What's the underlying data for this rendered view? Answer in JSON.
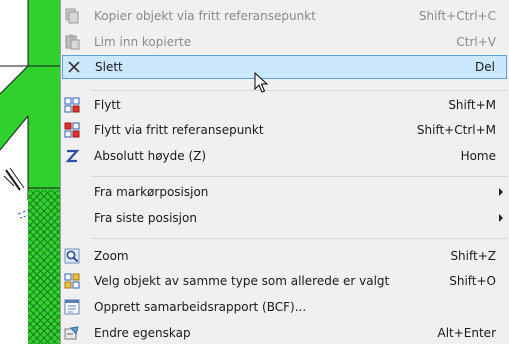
{
  "colors": {
    "menu_background": "#f0f0f0",
    "selected_highlight": "#cce8ff",
    "selected_border": "#5aa1e0",
    "canvas_green": "#2fd12f",
    "disabled_text": "#8a8a8a"
  },
  "menu": {
    "items": [
      {
        "label": "Kopier objekt via fritt referansepunkt",
        "shortcut": "Shift+Ctrl+C",
        "icon": "copy-icon",
        "state": "disabled"
      },
      {
        "label": "Lim inn kopierte",
        "shortcut": "Ctrl+V",
        "icon": "paste-icon",
        "state": "disabled"
      },
      {
        "label": "Slett",
        "shortcut": "Del",
        "icon": "delete-x-icon",
        "state": "selected"
      },
      {
        "label": "Flytt",
        "shortcut": "Shift+M",
        "icon": "move-icon",
        "state": "enabled"
      },
      {
        "label": "Flytt via fritt referansepunkt",
        "shortcut": "Shift+Ctrl+M",
        "icon": "move-reference-icon",
        "state": "enabled"
      },
      {
        "label": "Absolutt høyde (Z)",
        "shortcut": "Home",
        "icon": "z-height-icon",
        "state": "enabled"
      },
      {
        "label": "Fra markørposisjon",
        "shortcut": "",
        "icon": "",
        "state": "submenu"
      },
      {
        "label": "Fra siste posisjon",
        "shortcut": "",
        "icon": "",
        "state": "submenu"
      },
      {
        "label": "Zoom",
        "shortcut": "Shift+Z",
        "icon": "zoom-icon",
        "state": "enabled"
      },
      {
        "label": "Velg objekt av samme type som allerede er valgt",
        "shortcut": "Shift+O",
        "icon": "select-same-type-icon",
        "state": "enabled"
      },
      {
        "label": "Opprett samarbeidsrapport (BCF)...",
        "shortcut": "",
        "icon": "bcf-report-icon",
        "state": "enabled"
      },
      {
        "label": "Endre egenskap",
        "shortcut": "Alt+Enter",
        "icon": "properties-icon",
        "state": "enabled"
      }
    ]
  }
}
